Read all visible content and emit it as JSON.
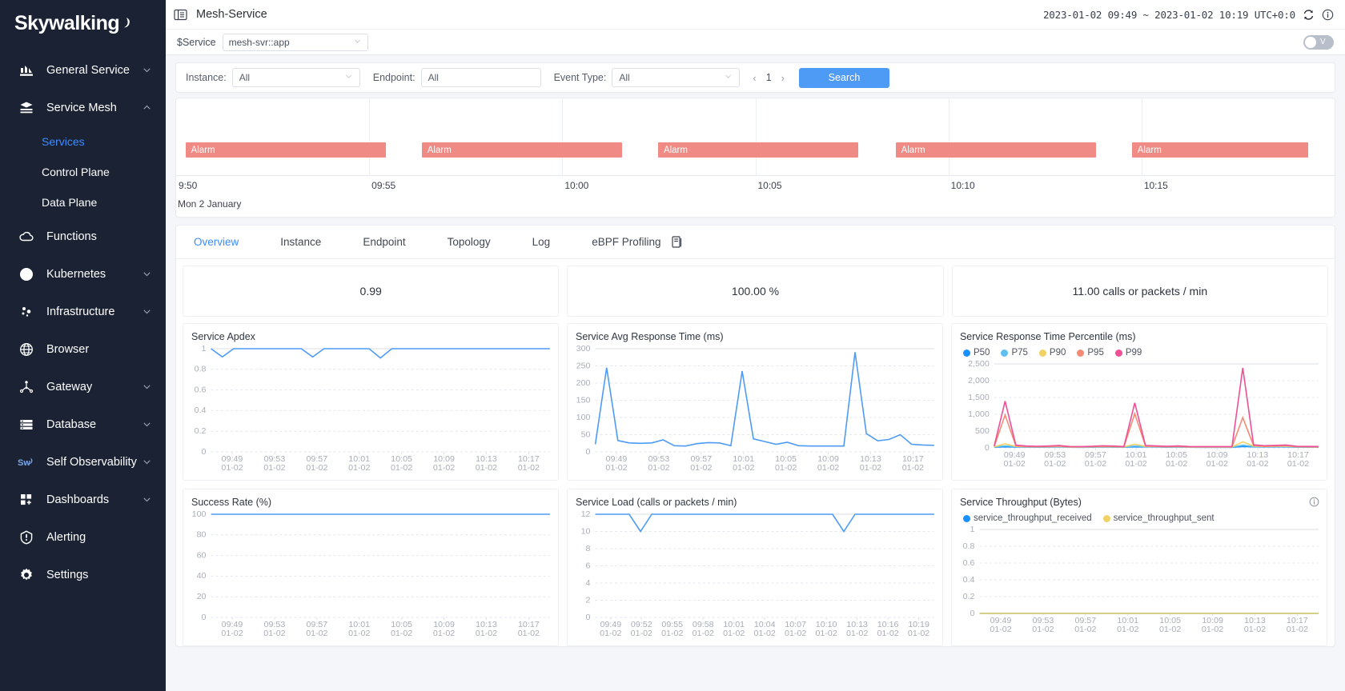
{
  "sidebar": {
    "logo": "Skywalking",
    "items": [
      {
        "label": "General Service",
        "icon": "bar-chart-icon",
        "caret": true
      },
      {
        "label": "Service Mesh",
        "icon": "layers-icon",
        "caret": true,
        "expanded": true,
        "children": [
          {
            "label": "Services",
            "active": true
          },
          {
            "label": "Control Plane",
            "active": false
          },
          {
            "label": "Data Plane",
            "active": false
          }
        ]
      },
      {
        "label": "Functions",
        "icon": "cloud-icon",
        "caret": false
      },
      {
        "label": "Kubernetes",
        "icon": "pie-chart-icon",
        "caret": true
      },
      {
        "label": "Infrastructure",
        "icon": "nodes-icon",
        "caret": true
      },
      {
        "label": "Browser",
        "icon": "globe-icon",
        "caret": false
      },
      {
        "label": "Gateway",
        "icon": "gateway-icon",
        "caret": true
      },
      {
        "label": "Database",
        "icon": "database-icon",
        "caret": true
      },
      {
        "label": "Self Observability",
        "icon": "sw-icon",
        "caret": true
      },
      {
        "label": "Dashboards",
        "icon": "dashboard-icon",
        "caret": true
      },
      {
        "label": "Alerting",
        "icon": "alert-icon",
        "caret": false
      },
      {
        "label": "Settings",
        "icon": "gear-icon",
        "caret": false
      }
    ]
  },
  "topbar": {
    "title": "Mesh-Service",
    "time_range": "2023-01-02 09:49 ~ 2023-01-02 10:19  UTC+0:0"
  },
  "service_selector": {
    "label": "$Service",
    "value": "mesh-svr::app",
    "toggle_label": "V"
  },
  "filters": {
    "instance": {
      "label": "Instance:",
      "value": "All"
    },
    "endpoint": {
      "label": "Endpoint:",
      "value": "All"
    },
    "event_type": {
      "label": "Event Type:",
      "value": "All"
    },
    "page": "1",
    "search_label": "Search"
  },
  "alarm_timeline": {
    "axis_date": "Mon 2 January",
    "ticks": [
      "9:50",
      "09:55",
      "10:00",
      "10:05",
      "10:10",
      "10:15"
    ],
    "bars": [
      {
        "label": "Alarm",
        "left_pct": 0.8,
        "width_pct": 17.3
      },
      {
        "label": "Alarm",
        "left_pct": 21.2,
        "width_pct": 17.3
      },
      {
        "label": "Alarm",
        "left_pct": 41.6,
        "width_pct": 17.3
      },
      {
        "label": "Alarm",
        "left_pct": 62.1,
        "width_pct": 17.3
      },
      {
        "label": "Alarm",
        "left_pct": 82.5,
        "width_pct": 15.2
      }
    ]
  },
  "tabs": [
    {
      "label": "Overview",
      "active": true
    },
    {
      "label": "Instance",
      "active": false
    },
    {
      "label": "Endpoint",
      "active": false
    },
    {
      "label": "Topology",
      "active": false
    },
    {
      "label": "Log",
      "active": false
    },
    {
      "label": "eBPF Profiling",
      "active": false
    }
  ],
  "metrics": [
    {
      "value": "0.99"
    },
    {
      "value": "100.00 %"
    },
    {
      "value": "11.00 calls or packets / min"
    }
  ],
  "colors": {
    "accent": "#3d8bff",
    "line_blue": "#4e9bf5",
    "alarm": "#f08a84",
    "p50": "#1890ff",
    "p75": "#5fc0f0",
    "p90": "#f0d264",
    "p95": "#f58b76",
    "p99": "#ef4f95",
    "sidebar_bg": "#1a2233"
  },
  "chart_data": [
    {
      "type": "line",
      "title": "Service Apdex",
      "xlabel": "",
      "ylabel": "",
      "ylim": [
        0,
        1
      ],
      "yticks": [
        0,
        0.2,
        0.4,
        0.6,
        0.8,
        1
      ],
      "ytick_labels": [
        "0",
        "0.2",
        "0.4",
        "0.6",
        "0.8",
        "1"
      ],
      "xtick_labels": [
        "09:49",
        "09:53",
        "09:57",
        "10:01",
        "10:05",
        "10:09",
        "10:13",
        "10:17"
      ],
      "xtick_sub": "01-02",
      "grid": true,
      "series": [
        {
          "name": "apdex",
          "color": "#4e9bf5",
          "values": [
            1,
            0.92,
            1,
            1,
            1,
            1,
            1,
            1,
            1,
            0.92,
            1,
            1,
            1,
            1,
            1,
            0.91,
            1,
            1,
            1,
            1,
            1,
            1,
            1,
            1,
            1,
            1,
            1,
            1,
            1,
            1,
            1
          ]
        }
      ]
    },
    {
      "type": "line",
      "title": "Service Avg Response Time (ms)",
      "ylim": [
        0,
        300
      ],
      "yticks": [
        0,
        50,
        100,
        150,
        200,
        250,
        300
      ],
      "ytick_labels": [
        "0",
        "50",
        "100",
        "150",
        "200",
        "250",
        "300"
      ],
      "xtick_labels": [
        "09:49",
        "09:53",
        "09:57",
        "10:01",
        "10:05",
        "10:09",
        "10:13",
        "10:17"
      ],
      "xtick_sub": "01-02",
      "grid": true,
      "series": [
        {
          "name": "avg_response_time",
          "color": "#4e9bf5",
          "values": [
            22,
            245,
            33,
            26,
            25,
            26,
            35,
            18,
            17,
            24,
            27,
            26,
            18,
            235,
            38,
            30,
            22,
            28,
            18,
            17,
            17,
            17,
            17,
            290,
            53,
            32,
            36,
            50,
            22,
            20,
            19
          ]
        }
      ]
    },
    {
      "type": "line",
      "title": "Service Response Time Percentile (ms)",
      "ylim": [
        0,
        2500
      ],
      "yticks": [
        0,
        500,
        1000,
        1500,
        2000,
        2500
      ],
      "ytick_labels": [
        "0",
        "500",
        "1,000",
        "1,500",
        "2,000",
        "2,500"
      ],
      "xtick_labels": [
        "09:49",
        "09:53",
        "09:57",
        "10:01",
        "10:05",
        "10:09",
        "10:13",
        "10:17"
      ],
      "xtick_sub": "01-02",
      "grid": true,
      "legend": [
        "P50",
        "P75",
        "P90",
        "P95",
        "P99"
      ],
      "legend_position": "top",
      "series": [
        {
          "name": "P50",
          "color": "#1890ff",
          "values": [
            20,
            30,
            25,
            22,
            20,
            22,
            28,
            18,
            17,
            20,
            24,
            22,
            18,
            30,
            28,
            24,
            20,
            24,
            18,
            17,
            17,
            17,
            17,
            40,
            30,
            25,
            28,
            30,
            20,
            19,
            18
          ]
        },
        {
          "name": "P75",
          "color": "#5fc0f0",
          "values": [
            25,
            60,
            35,
            28,
            25,
            28,
            34,
            22,
            20,
            25,
            30,
            28,
            22,
            55,
            34,
            30,
            25,
            30,
            22,
            20,
            20,
            20,
            20,
            80,
            40,
            32,
            36,
            40,
            25,
            23,
            22
          ]
        },
        {
          "name": "P90",
          "color": "#f0d264",
          "values": [
            30,
            120,
            45,
            34,
            30,
            34,
            42,
            26,
            24,
            30,
            38,
            34,
            26,
            110,
            42,
            36,
            30,
            36,
            26,
            24,
            24,
            24,
            24,
            180,
            55,
            40,
            46,
            52,
            30,
            28,
            26
          ]
        },
        {
          "name": "P95",
          "color": "#f58b76",
          "values": [
            40,
            980,
            60,
            42,
            38,
            42,
            52,
            32,
            30,
            38,
            48,
            42,
            32,
            1020,
            52,
            45,
            38,
            45,
            32,
            30,
            30,
            30,
            30,
            900,
            70,
            50,
            58,
            66,
            38,
            34,
            32
          ]
        },
        {
          "name": "P99",
          "color": "#ef4f95",
          "values": [
            60,
            1390,
            80,
            55,
            48,
            55,
            68,
            40,
            38,
            48,
            62,
            55,
            40,
            1340,
            68,
            58,
            48,
            58,
            40,
            38,
            38,
            38,
            38,
            2380,
            90,
            64,
            74,
            86,
            48,
            44,
            40
          ]
        }
      ]
    },
    {
      "type": "line",
      "title": "Success Rate (%)",
      "ylim": [
        0,
        100
      ],
      "yticks": [
        0,
        20,
        40,
        60,
        80,
        100
      ],
      "ytick_labels": [
        "0",
        "20",
        "40",
        "60",
        "80",
        "100"
      ],
      "xtick_labels": [
        "09:49",
        "09:53",
        "09:57",
        "10:01",
        "10:05",
        "10:09",
        "10:13",
        "10:17"
      ],
      "xtick_sub": "01-02",
      "grid": true,
      "series": [
        {
          "name": "success_rate",
          "color": "#4e9bf5",
          "values": [
            100,
            100,
            100,
            100,
            100,
            100,
            100,
            100,
            100,
            100,
            100,
            100,
            100,
            100,
            100,
            100,
            100,
            100,
            100,
            100,
            100,
            100,
            100,
            100,
            100,
            100,
            100,
            100,
            100,
            100,
            100
          ]
        }
      ]
    },
    {
      "type": "line",
      "title": "Service Load (calls or packets / min)",
      "ylim": [
        0,
        12
      ],
      "yticks": [
        0,
        2,
        4,
        6,
        8,
        10,
        12
      ],
      "ytick_labels": [
        "0",
        "2",
        "4",
        "6",
        "8",
        "10",
        "12"
      ],
      "xtick_labels": [
        "09:49",
        "09:52",
        "09:55",
        "09:58",
        "10:01",
        "10:04",
        "10:07",
        "10:10",
        "10:13",
        "10:16",
        "10:19"
      ],
      "xtick_sub": "01-02",
      "grid": true,
      "series": [
        {
          "name": "service_load",
          "color": "#4e9bf5",
          "values": [
            12,
            12,
            12,
            12,
            10,
            12,
            12,
            12,
            12,
            12,
            12,
            12,
            12,
            12,
            12,
            12,
            12,
            12,
            12,
            12,
            12,
            12,
            10,
            12,
            12,
            12,
            12,
            12,
            12,
            12,
            12
          ]
        }
      ]
    },
    {
      "type": "line",
      "title": "Service Throughput (Bytes)",
      "ylim": [
        0,
        1
      ],
      "yticks": [
        0,
        0.2,
        0.4,
        0.6,
        0.8,
        1
      ],
      "ytick_labels": [
        "0",
        "0.2",
        "0.4",
        "0.6",
        "0.8",
        "1"
      ],
      "xtick_labels": [
        "09:49",
        "09:53",
        "09:57",
        "10:01",
        "10:05",
        "10:09",
        "10:13",
        "10:17"
      ],
      "xtick_sub": "01-02",
      "grid": true,
      "legend": [
        "service_throughput_received",
        "service_throughput_sent"
      ],
      "legend_position": "top",
      "has_info_icon": true,
      "series": [
        {
          "name": "service_throughput_received",
          "color": "#1890ff",
          "values": [
            0,
            0,
            0,
            0,
            0,
            0,
            0,
            0,
            0,
            0,
            0,
            0,
            0,
            0,
            0,
            0,
            0,
            0,
            0,
            0,
            0,
            0,
            0,
            0,
            0,
            0,
            0,
            0,
            0,
            0,
            0
          ]
        },
        {
          "name": "service_throughput_sent",
          "color": "#f0d264",
          "values": [
            0,
            0,
            0,
            0,
            0,
            0,
            0,
            0,
            0,
            0,
            0,
            0,
            0,
            0,
            0,
            0,
            0,
            0,
            0,
            0,
            0,
            0,
            0,
            0,
            0,
            0,
            0,
            0,
            0,
            0,
            0
          ]
        }
      ]
    }
  ]
}
